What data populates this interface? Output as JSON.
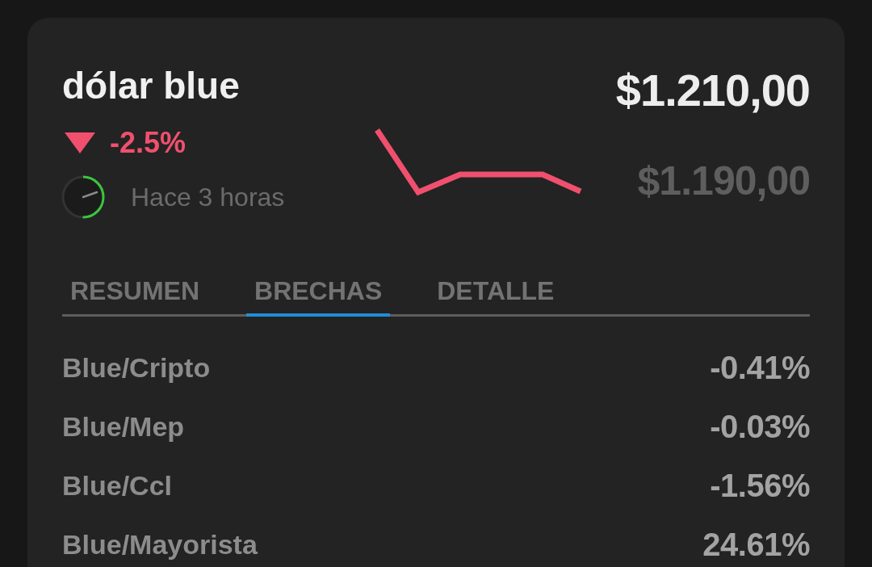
{
  "card": {
    "title": "dólar blue",
    "change": {
      "falling": true,
      "text": "-2.5%"
    },
    "updated": {
      "text": "Hace 3 horas",
      "level": 0.5
    },
    "prices": [
      {
        "kind": "primary",
        "text": "$1.210,00"
      },
      {
        "kind": "secondary",
        "text": "$1.190,00"
      }
    ]
  },
  "tabs": [
    {
      "label": "RESUMEN",
      "selected": false
    },
    {
      "label": "BRECHAS",
      "selected": true
    },
    {
      "label": "DETALLE",
      "selected": false
    }
  ],
  "rows": [
    {
      "label": "Blue/Cripto",
      "value": "-0.41%"
    },
    {
      "label": "Blue/Mep",
      "value": "-0.03%"
    },
    {
      "label": "Blue/Ccl",
      "value": "-1.56%"
    },
    {
      "label": "Blue/Mayorista",
      "value": "24.61%"
    }
  ]
}
